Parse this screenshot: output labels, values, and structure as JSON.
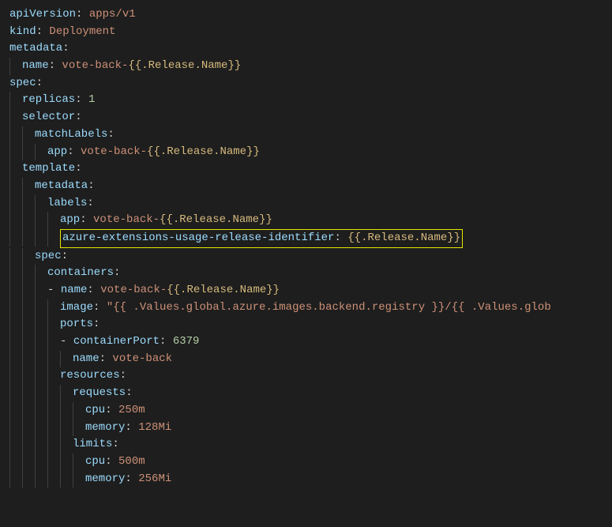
{
  "code": {
    "l1": {
      "k": "apiVersion",
      "v": "apps/v1"
    },
    "l2": {
      "k": "kind",
      "v": "Deployment"
    },
    "l3": {
      "k": "metadata"
    },
    "l4": {
      "k": "name",
      "v": "vote-back-",
      "t": "{{.Release.Name}}"
    },
    "l5": {
      "k": "spec"
    },
    "l6": {
      "k": "replicas",
      "v": "1"
    },
    "l7": {
      "k": "selector"
    },
    "l8": {
      "k": "matchLabels"
    },
    "l9": {
      "k": "app",
      "v": "vote-back-",
      "t": "{{.Release.Name}}"
    },
    "l10": {
      "k": "template"
    },
    "l11": {
      "k": "metadata"
    },
    "l12": {
      "k": "labels"
    },
    "l13": {
      "k": "app",
      "v": "vote-back-",
      "t": "{{.Release.Name}}"
    },
    "l14": {
      "k": "azure-extensions-usage-release-identifier",
      "t": "{{.Release.Name}}"
    },
    "l15": {
      "k": "spec"
    },
    "l16": {
      "k": "containers"
    },
    "l17": {
      "k": "name",
      "v": "vote-back-",
      "t": "{{.Release.Name}}"
    },
    "l18": {
      "k": "image",
      "v": "\"{{ .Values.global.azure.images.backend.registry }}/{{ .Values.glob"
    },
    "l19": {
      "k": "ports"
    },
    "l20": {
      "k": "containerPort",
      "v": "6379"
    },
    "l21": {
      "k": "name",
      "v": "vote-back"
    },
    "l22": {
      "k": "resources"
    },
    "l23": {
      "k": "requests"
    },
    "l24": {
      "k": "cpu",
      "v": "250m"
    },
    "l25": {
      "k": "memory",
      "v": "128Mi"
    },
    "l26": {
      "k": "limits"
    },
    "l27": {
      "k": "cpu",
      "v": "500m"
    },
    "l28": {
      "k": "memory",
      "v": "256Mi"
    }
  }
}
